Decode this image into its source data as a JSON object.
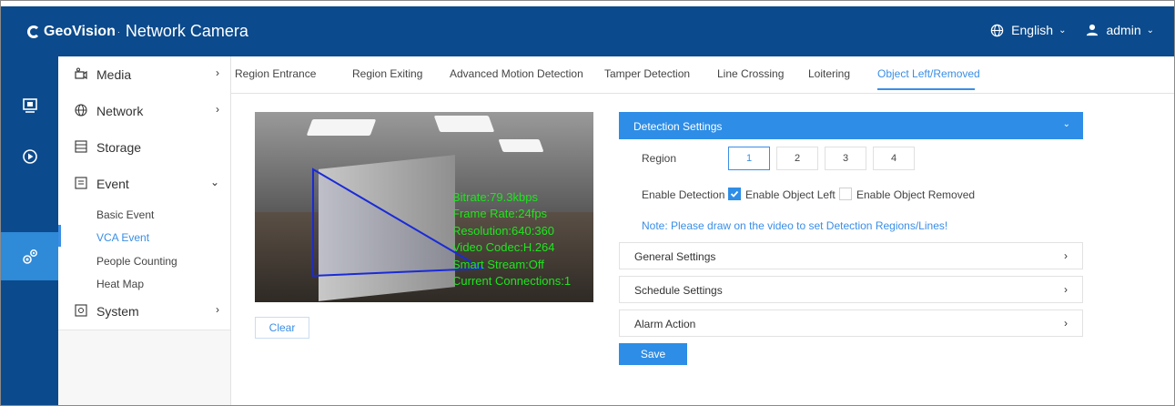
{
  "header": {
    "brand": "GeoVision",
    "brand_suffix": "Network Camera",
    "language": "English",
    "user": "admin"
  },
  "sidebar": {
    "items": [
      {
        "label": "Media",
        "icon": "media-icon",
        "arrow": "›"
      },
      {
        "label": "Network",
        "icon": "globe-icon",
        "arrow": "›"
      },
      {
        "label": "Storage",
        "icon": "storage-icon",
        "arrow": ""
      },
      {
        "label": "Event",
        "icon": "event-icon",
        "arrow": "⌄"
      },
      {
        "label": "System",
        "icon": "system-icon",
        "arrow": "›"
      }
    ],
    "sub_items": [
      "Basic Event",
      "VCA Event",
      "People Counting",
      "Heat Map"
    ]
  },
  "tabs": [
    "Region Entrance",
    "Region Exiting",
    "Advanced Motion Detection",
    "Tamper Detection",
    "Line Crossing",
    "Loitering",
    "Object Left/Removed"
  ],
  "video": {
    "osd": [
      "Bitrate:79.3kbps",
      "Frame Rate:24fps",
      "Resolution:640:360",
      "Video Codec:H.264",
      "Smart Stream:Off",
      "Current Connections:1"
    ],
    "clear_label": "Clear"
  },
  "detection": {
    "title": "Detection Settings",
    "region_label": "Region",
    "regions": [
      "1",
      "2",
      "3",
      "4"
    ],
    "enable_label": "Enable Detection",
    "enable_left_label": "Enable Object Left",
    "enable_removed_label": "Enable Object Removed",
    "note": "Note: Please draw on the video to set Detection Regions/Lines!"
  },
  "sections": [
    "General Settings",
    "Schedule Settings",
    "Alarm Action"
  ],
  "save_label": "Save",
  "colors": {
    "header": "#0b4a8c",
    "accent": "#2e8de6",
    "osd_text": "#1ee61e",
    "region_line": "#1a2bd6"
  }
}
